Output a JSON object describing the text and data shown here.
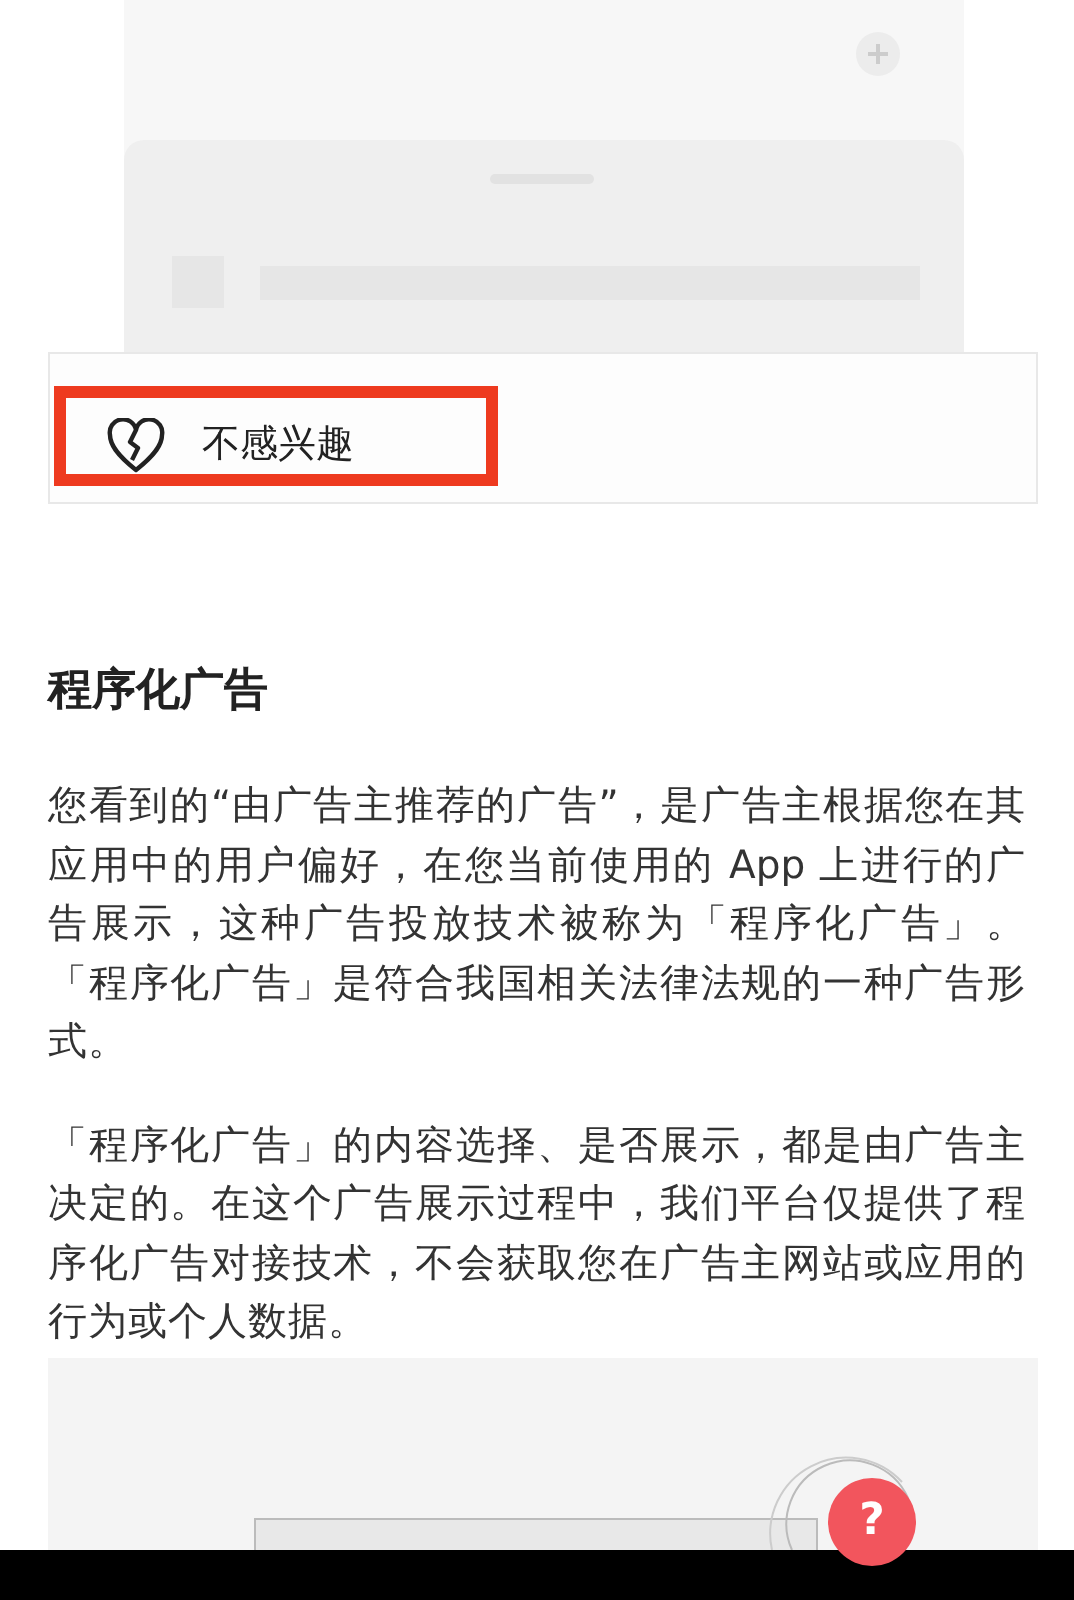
{
  "feedback_menu": {
    "items": [
      {
        "label": "不感兴趣",
        "highlighted": true
      }
    ]
  },
  "section": {
    "title": "程序化广告",
    "paragraphs": [
      "您看到的“由广告主推荐的广告”，是广告主根据您在其应用中的用户偏好，在您当前使用的 App 上进行的广告展示，这种广告投放技术被称为「程序化广告」。「程序化广告」是符合我国相关法律法规的一种广告形式。",
      "「程序化广告」的内容选择、是否展示，都是由广告主决定的。在这个广告展示过程中，我们平台仅提供了程序化广告对接技术，不会获取您在广告主网站或应用的行为或个人数据。"
    ]
  },
  "illustration": {
    "badge": "?"
  }
}
